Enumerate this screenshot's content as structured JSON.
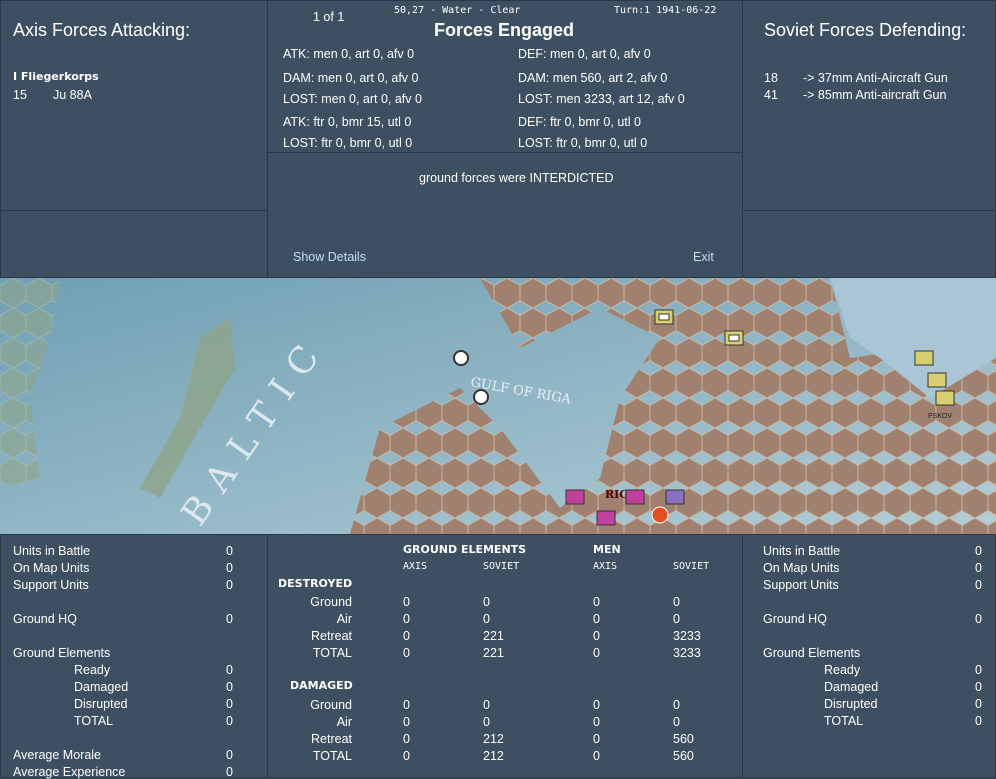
{
  "axis": {
    "title": "Axis Forces Attacking:",
    "hq": "I Fliegerkorps",
    "units": [
      {
        "count": "15",
        "name": "Ju 88A"
      }
    ]
  },
  "soviet": {
    "title": "Soviet Forces Defending:",
    "units": [
      {
        "count": "18",
        "name": "-> 37mm Anti-Aircraft Gun"
      },
      {
        "count": "41",
        "name": "-> 85mm Anti-aircraft Gun"
      }
    ]
  },
  "center": {
    "page": "1 of 1",
    "location": "50,27 - Water - Clear",
    "turn": "Turn:1  1941-06-22",
    "title": "Forces Engaged",
    "left": [
      "ATK: men 0, art 0, afv 0",
      "DAM: men 0, art 0, afv 0",
      "LOST: men 0, art 0, afv 0",
      "ATK: ftr 0, bmr 15, utl 0",
      "LOST: ftr 0, bmr 0, utl 0"
    ],
    "right": [
      "DEF: men 0, art 0, afv 0",
      "DAM: men 560, art 2, afv 0",
      "LOST: men 3233, art 12, afv 0",
      "DEF: ftr 0, bmr 0, utl 0",
      "LOST: ftr 0, bmr 0, utl 0"
    ],
    "result": "ground forces were INTERDICTED",
    "show_details": "Show Details",
    "exit": "Exit"
  },
  "map": {
    "labels": {
      "baltic": "BALTIC",
      "gulf": "GULF OF RIGA",
      "riga": "RIGA",
      "pskov": "PSKOV"
    }
  },
  "stats_axis": [
    [
      "Units in Battle",
      "0"
    ],
    [
      "On Map Units",
      "0"
    ],
    [
      "Support Units",
      "0"
    ],
    [
      "Ground HQ",
      "0"
    ],
    [
      "Ground Elements",
      ""
    ],
    [
      "Ready",
      "0"
    ],
    [
      "Damaged",
      "0"
    ],
    [
      "Disrupted",
      "0"
    ],
    [
      "TOTAL",
      "0"
    ],
    [
      "Average Morale",
      "0"
    ],
    [
      "Average Experience",
      "0"
    ]
  ],
  "stats_soviet": [
    [
      "Units in Battle",
      "0"
    ],
    [
      "On Map Units",
      "0"
    ],
    [
      "Support Units",
      "0"
    ],
    [
      "Ground HQ",
      "0"
    ],
    [
      "Ground Elements",
      ""
    ],
    [
      "Ready",
      "0"
    ],
    [
      "Damaged",
      "0"
    ],
    [
      "Disrupted",
      "0"
    ],
    [
      "TOTAL",
      "0"
    ]
  ],
  "losses": {
    "h_ground": "GROUND ELEMENTS",
    "h_men": "MEN",
    "axis": "AXIS",
    "soviet": "SOVIET",
    "destroyed": "DESTROYED",
    "damaged": "DAMAGED",
    "destroyed_rows": [
      [
        "Ground",
        "0",
        "0",
        "0",
        "0"
      ],
      [
        "Air",
        "0",
        "0",
        "0",
        "0"
      ],
      [
        "Retreat",
        "0",
        "221",
        "0",
        "3233"
      ],
      [
        "TOTAL",
        "0",
        "221",
        "0",
        "3233"
      ]
    ],
    "damaged_rows": [
      [
        "Ground",
        "0",
        "0",
        "0",
        "0"
      ],
      [
        "Air",
        "0",
        "0",
        "0",
        "0"
      ],
      [
        "Retreat",
        "0",
        "212",
        "0",
        "560"
      ],
      [
        "TOTAL",
        "0",
        "212",
        "0",
        "560"
      ]
    ]
  }
}
